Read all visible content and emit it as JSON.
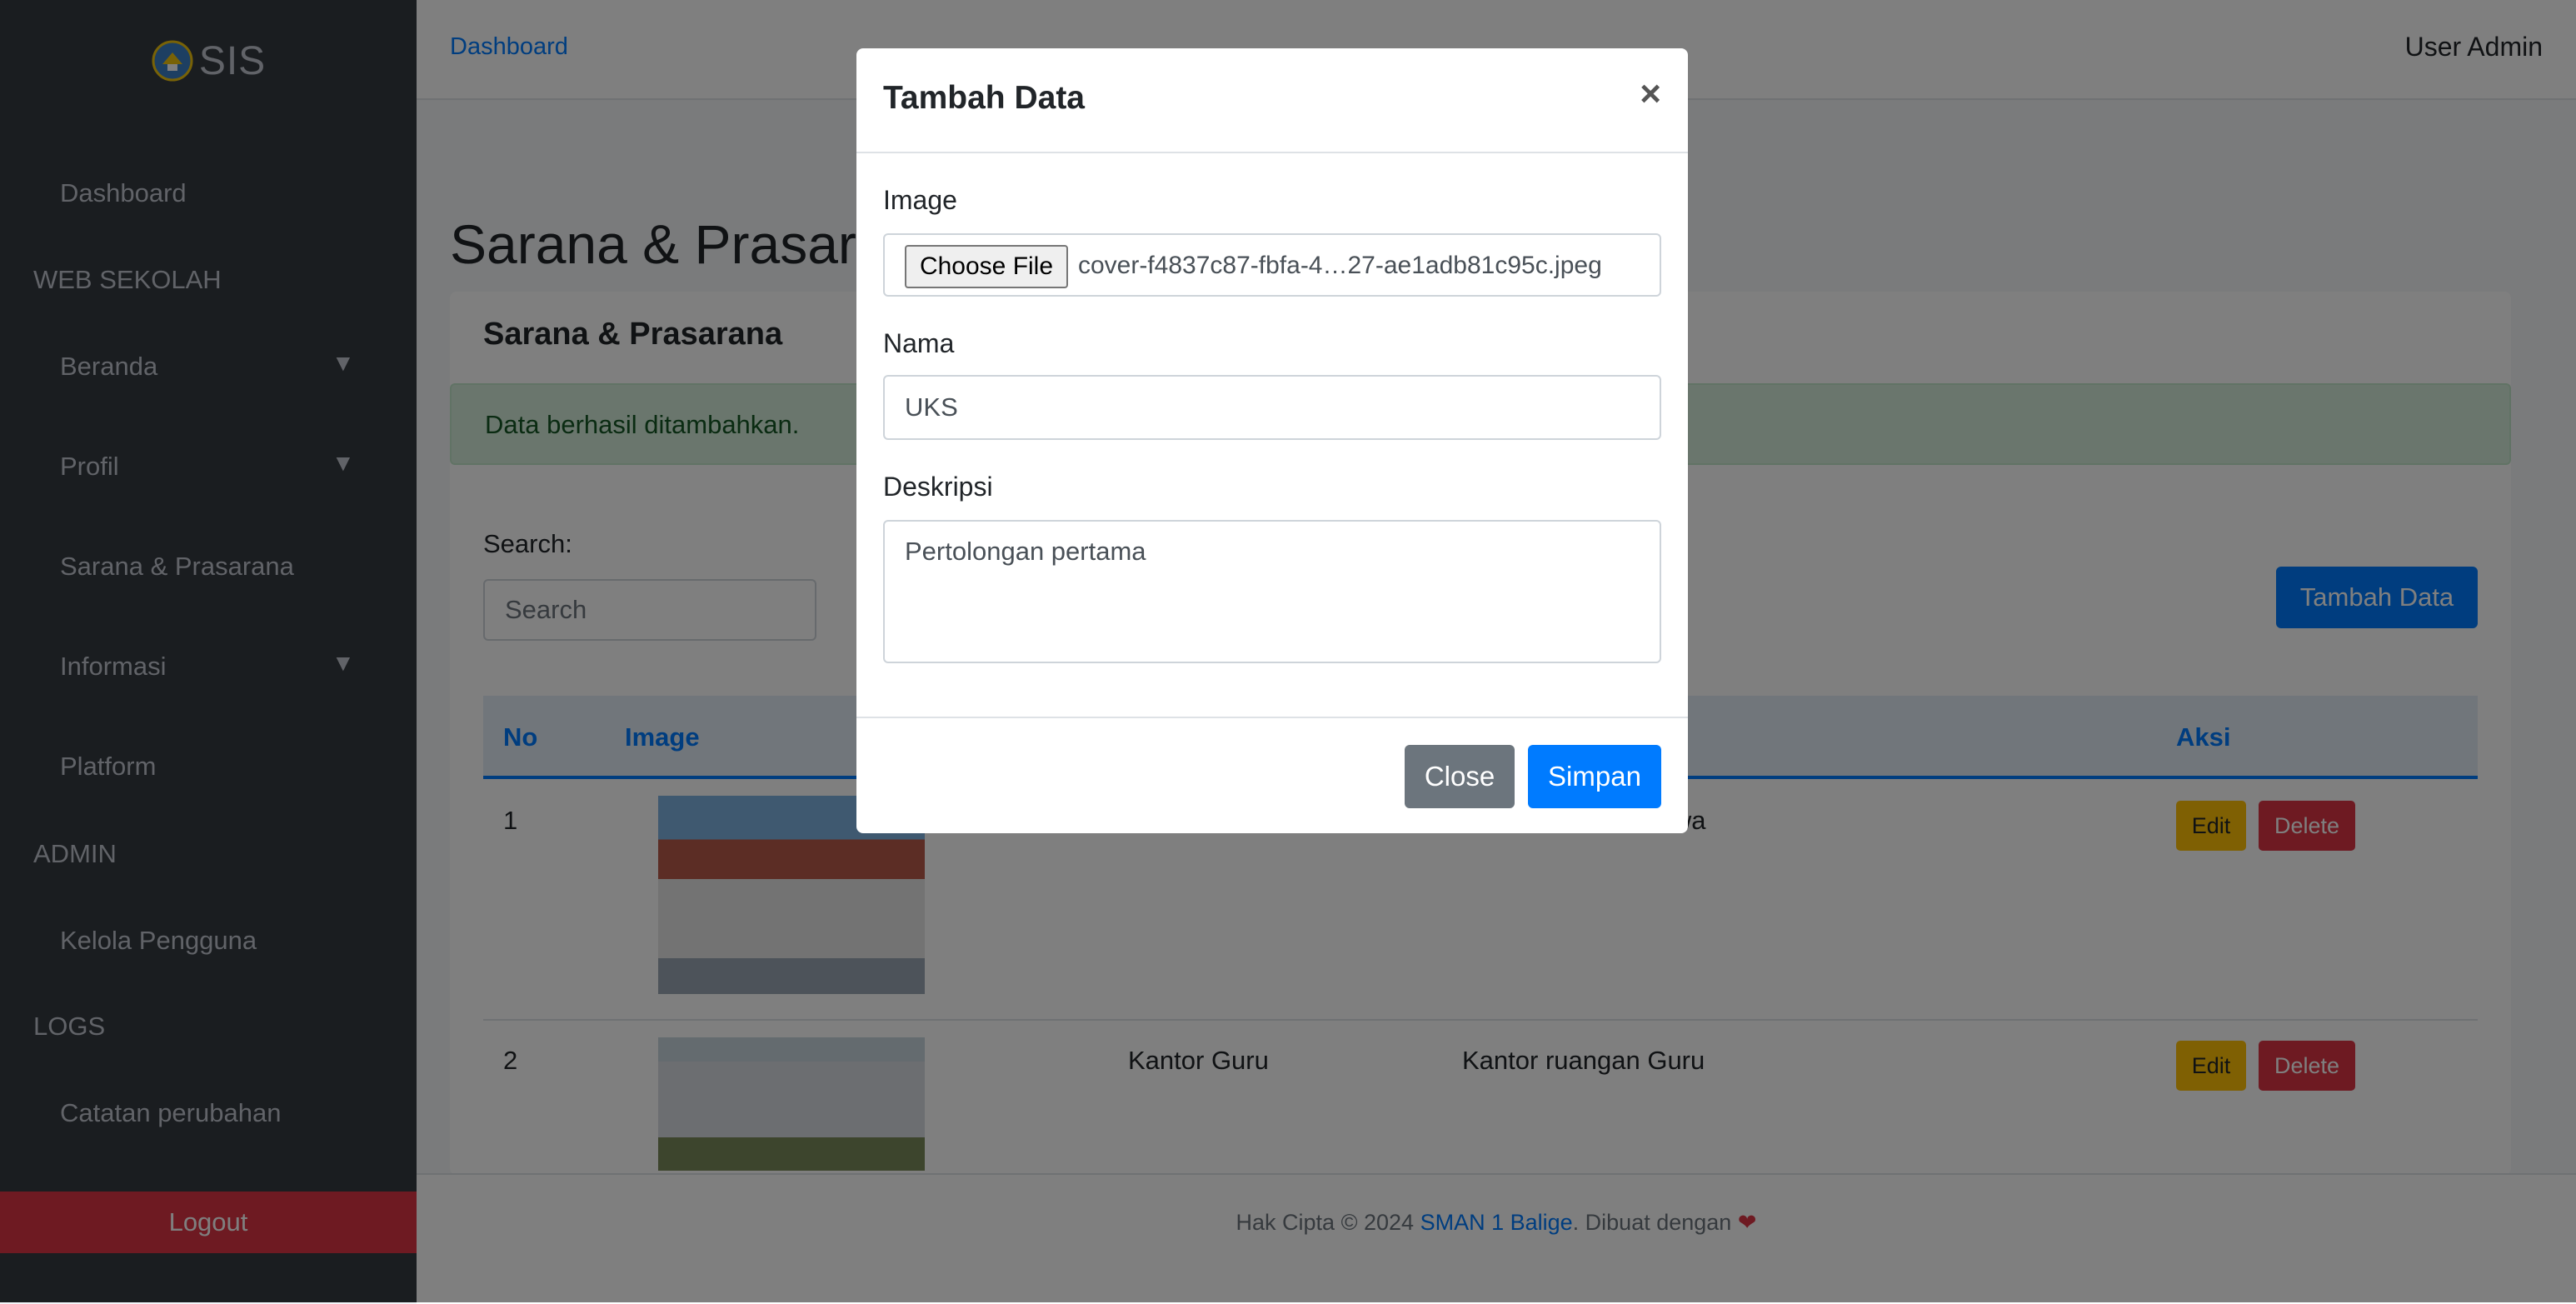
{
  "sidebar": {
    "brand": "SIS",
    "items": [
      {
        "label": "Dashboard"
      },
      {
        "header": "WEB SEKOLAH"
      },
      {
        "label": "Beranda",
        "caret": "▼"
      },
      {
        "label": "Profil",
        "caret": "▼"
      },
      {
        "label": "Sarana & Prasarana"
      },
      {
        "label": "Informasi",
        "caret": "▼"
      },
      {
        "label": "Platform"
      },
      {
        "header": "ADMIN"
      },
      {
        "label": "Kelola Pengguna"
      },
      {
        "header": "LOGS"
      },
      {
        "label": "Catatan perubahan"
      }
    ],
    "logout": "Logout"
  },
  "topnav": {
    "breadcrumb": "Dashboard",
    "user": "User Admin"
  },
  "main": {
    "page_title": "Sarana & Prasarana",
    "card_title": "Sarana & Prasarana",
    "alert": "Data berhasil ditambahkan.",
    "search_label": "Search:",
    "search_placeholder": "Search",
    "add_button": "Tambah Data",
    "table": {
      "headers": [
        "No",
        "Image",
        "Aksi"
      ],
      "rows": [
        {
          "no": "1",
          "nama": "",
          "deskripsi": "siswa",
          "edit": "Edit",
          "delete": "Delete"
        },
        {
          "no": "2",
          "nama": "Kantor Guru",
          "deskripsi": "Kantor ruangan Guru",
          "edit": "Edit",
          "delete": "Delete"
        }
      ]
    }
  },
  "footer": {
    "prefix": "Hak Cipta © 2024",
    "link": "SMAN 1 Balige",
    "suffix": ". Dibuat dengan",
    "heart": "❤"
  },
  "modal": {
    "title": "Tambah Data",
    "close_symbol": "×",
    "image_label": "Image",
    "choose_file": "Choose File",
    "file_name": "cover-f4837c87-fbfa-4…27-ae1adb81c95c.jpeg",
    "nama_label": "Nama",
    "nama_value": "UKS",
    "deskripsi_label": "Deskripsi",
    "deskripsi_value": "Pertolongan pertama",
    "close_button": "Close",
    "save_button": "Simpan"
  },
  "colors": {
    "sidebar_bg": "#343a40",
    "primary": "#007bff",
    "danger": "#dc3545",
    "warning": "#ffc107",
    "secondary": "#6c757d",
    "alert_bg": "#d4edda"
  }
}
